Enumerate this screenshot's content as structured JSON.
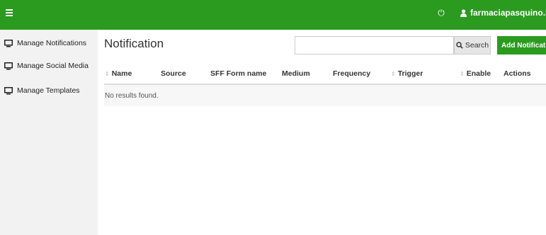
{
  "topbar": {
    "menu_icon": "hamburger-icon",
    "power_icon": "power-icon",
    "user_icon": "user-icon",
    "username": "farmaciapasquino.it",
    "color": "#2a9b1f"
  },
  "sidebar": {
    "items": [
      {
        "label": "Manage Notifications",
        "icon": "monitor-icon"
      },
      {
        "label": "Manage Social Media",
        "icon": "monitor-icon"
      },
      {
        "label": "Manage Templates",
        "icon": "monitor-icon"
      }
    ]
  },
  "main": {
    "title": "Notification",
    "search": {
      "placeholder": "",
      "value": "",
      "button_label": "Search",
      "icon": "search-icon"
    },
    "add_button_label": "Add Notification",
    "table": {
      "columns": [
        {
          "label": "Name",
          "sortable": true
        },
        {
          "label": "Source",
          "sortable": false
        },
        {
          "label": "SFF Form name",
          "sortable": false
        },
        {
          "label": "Medium",
          "sortable": false
        },
        {
          "label": "Frequency",
          "sortable": false
        },
        {
          "label": "Trigger",
          "sortable": true
        },
        {
          "label": "Enable",
          "sortable": true
        },
        {
          "label": "Actions",
          "sortable": false
        }
      ],
      "empty_text": "No results found."
    }
  }
}
